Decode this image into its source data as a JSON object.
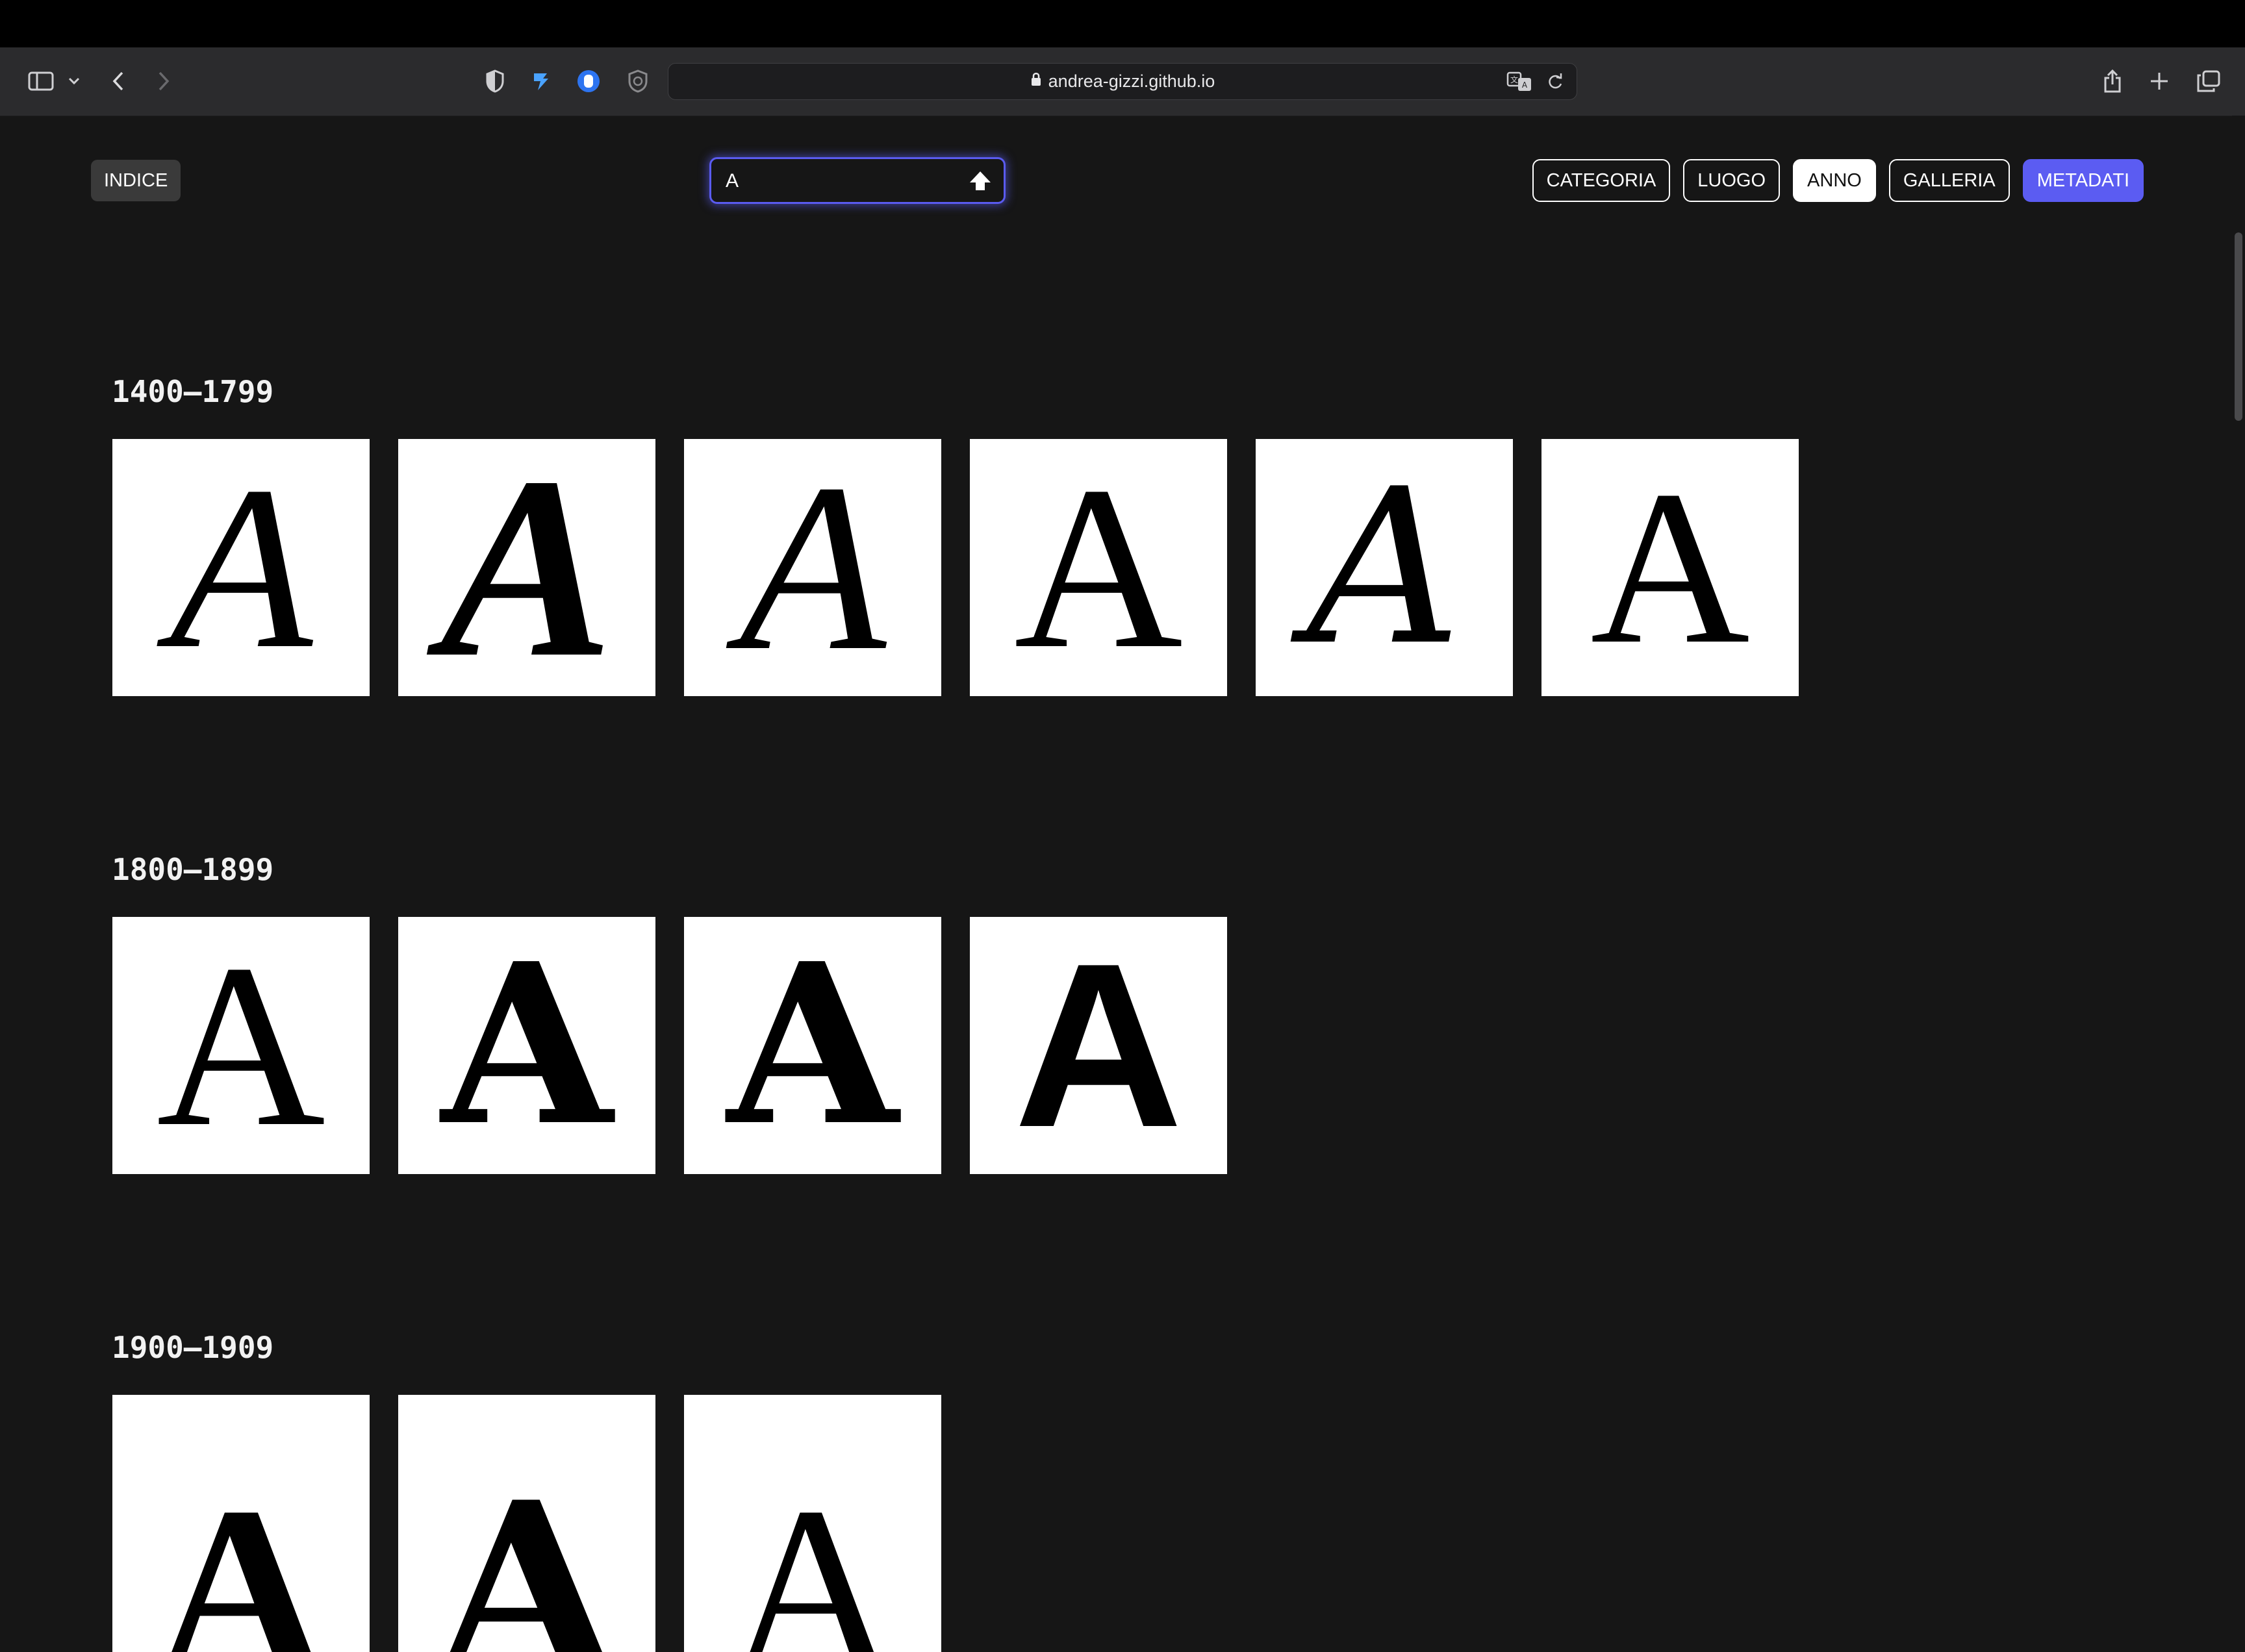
{
  "browser": {
    "url": "andrea-gizzi.github.io",
    "icons": [
      "sidebar-icon",
      "chevron-down-icon",
      "back-icon",
      "forward-icon",
      "shield-icon",
      "extension-icon",
      "privacy-icon",
      "block-icon",
      "lock-icon",
      "translate-icon",
      "reload-icon",
      "share-icon",
      "new-tab-icon",
      "tabs-icon"
    ]
  },
  "header": {
    "index_label": "INDICE",
    "search_value": "A",
    "filters": [
      {
        "label": "CATEGORIA",
        "state": "default"
      },
      {
        "label": "LUOGO",
        "state": "default"
      },
      {
        "label": "ANNO",
        "state": "active"
      },
      {
        "label": "GALLERIA",
        "state": "default"
      },
      {
        "label": "METADATI",
        "state": "accent"
      }
    ]
  },
  "colors": {
    "background": "#161616",
    "accent": "#5b5cf2",
    "tile": "#ffffff"
  },
  "sections": [
    {
      "title": "1400–1799",
      "tiles": [
        "A",
        "A",
        "A",
        "A",
        "A",
        "A"
      ]
    },
    {
      "title": "1800–1899",
      "tiles": [
        "A",
        "A",
        "A",
        "A"
      ]
    },
    {
      "title": "1900–1909",
      "tiles": [
        "A",
        "A",
        "A"
      ]
    }
  ]
}
